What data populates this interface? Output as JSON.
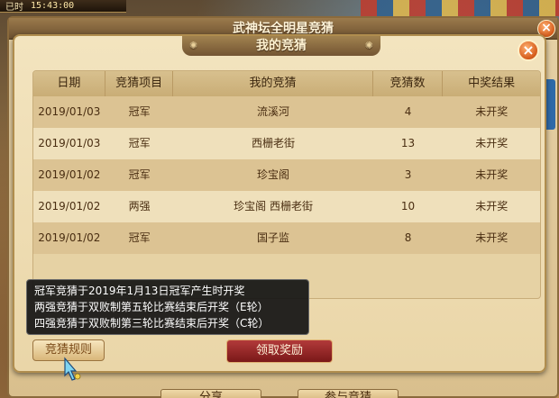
{
  "hud": {
    "status": "已时",
    "time": "15:43:00"
  },
  "outer_dialog": {
    "title": "武神坛全明星竞猜",
    "close_label": "×",
    "bottom_buttons": [
      "分享",
      "参与竞猜"
    ]
  },
  "dialog": {
    "title": "我的竞猜",
    "close_label": "×",
    "columns": [
      "日期",
      "竞猜项目",
      "我的竞猜",
      "竞猜数",
      "中奖结果"
    ],
    "rows": [
      {
        "date": "2019/01/03",
        "item": "冠军",
        "pick": "流溪河",
        "count": "4",
        "result": "未开奖"
      },
      {
        "date": "2019/01/03",
        "item": "冠军",
        "pick": "西栅老街",
        "count": "13",
        "result": "未开奖"
      },
      {
        "date": "2019/01/02",
        "item": "冠军",
        "pick": "珍宝阁",
        "count": "3",
        "result": "未开奖"
      },
      {
        "date": "2019/01/02",
        "item": "两强",
        "pick": "珍宝阁 西栅老街",
        "count": "10",
        "result": "未开奖"
      },
      {
        "date": "2019/01/02",
        "item": "冠军",
        "pick": "国子监",
        "count": "8",
        "result": "未开奖"
      }
    ],
    "tooltip_lines": [
      "冠军竞猜于2019年1月13日冠军产生时开奖",
      "两强竞猜于双败制第五轮比赛结束后开奖（E轮）",
      "四强竞猜于双败制第三轮比赛结束后开奖（C轮）"
    ],
    "rules_button": "竞猜规则",
    "claim_button": "领取奖励"
  },
  "colors": {
    "frame": "#b08d4e",
    "row_alt": "#dcc393",
    "row_norm": "#efe0bb",
    "claim_button": "#9b2828",
    "tooltip_bg": "#141414"
  }
}
